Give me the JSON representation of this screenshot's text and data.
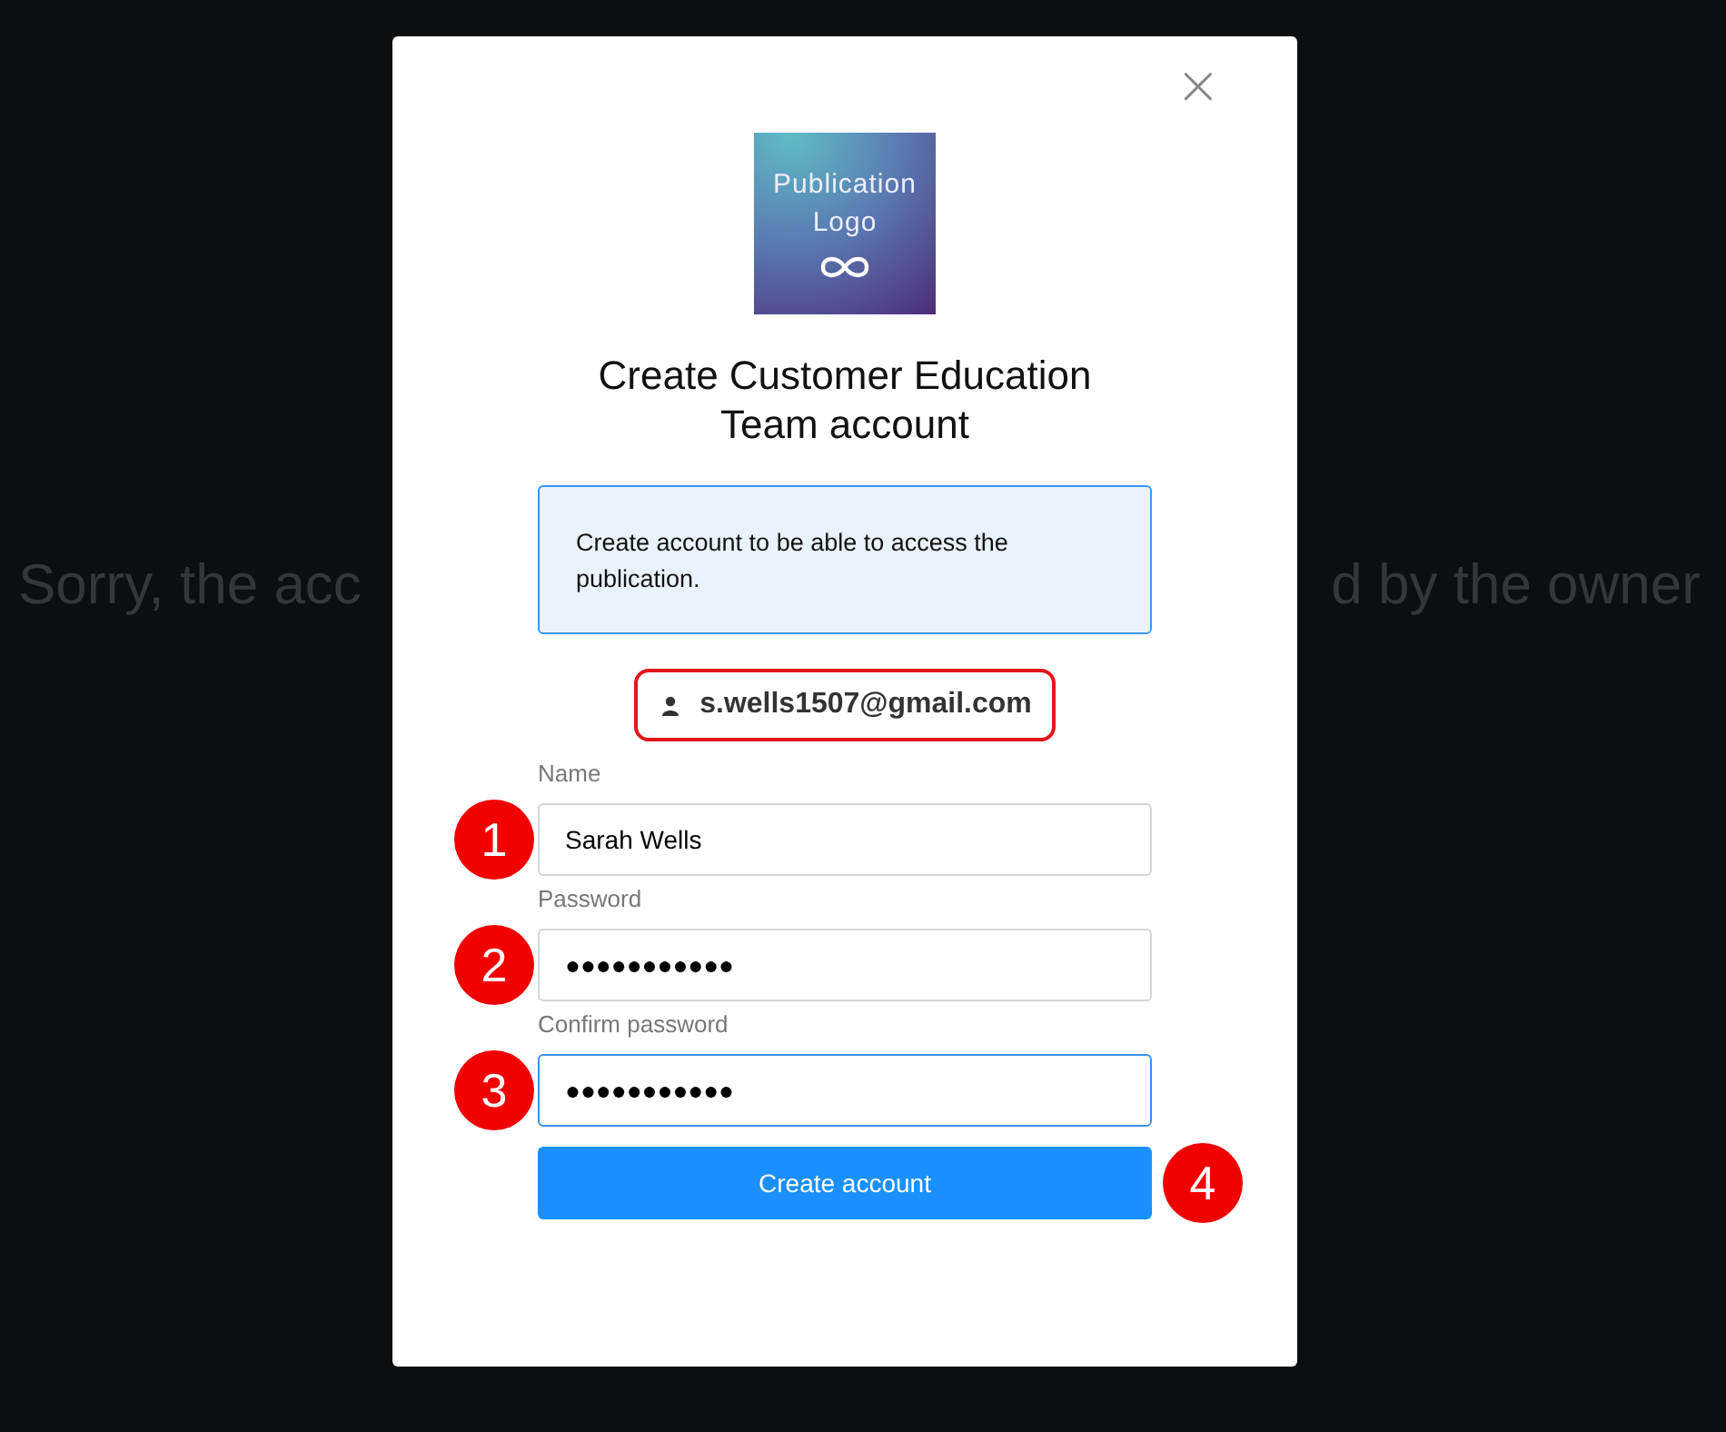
{
  "background_message": {
    "left_fragment": "Sorry, the acc",
    "right_fragment": "d by the owner"
  },
  "dialog": {
    "close": "×",
    "logo": {
      "line_1": "Publication",
      "line_2": "Logo"
    },
    "title": "Create Customer Education Team account",
    "info": "Create account to be able to access the publication.",
    "email": "s.wells1507@gmail.com",
    "fields": [
      {
        "label": "Name",
        "value": "Sarah Wells",
        "focused": false,
        "marker": "1"
      },
      {
        "label": "Password",
        "value": "●●●●●●●●●●●",
        "focused": false,
        "marker": "2"
      },
      {
        "label": "Confirm password",
        "value": "●●●●●●●●●●●",
        "focused": true,
        "marker": "3"
      }
    ],
    "button": {
      "label": "Create account",
      "marker": "4"
    }
  }
}
